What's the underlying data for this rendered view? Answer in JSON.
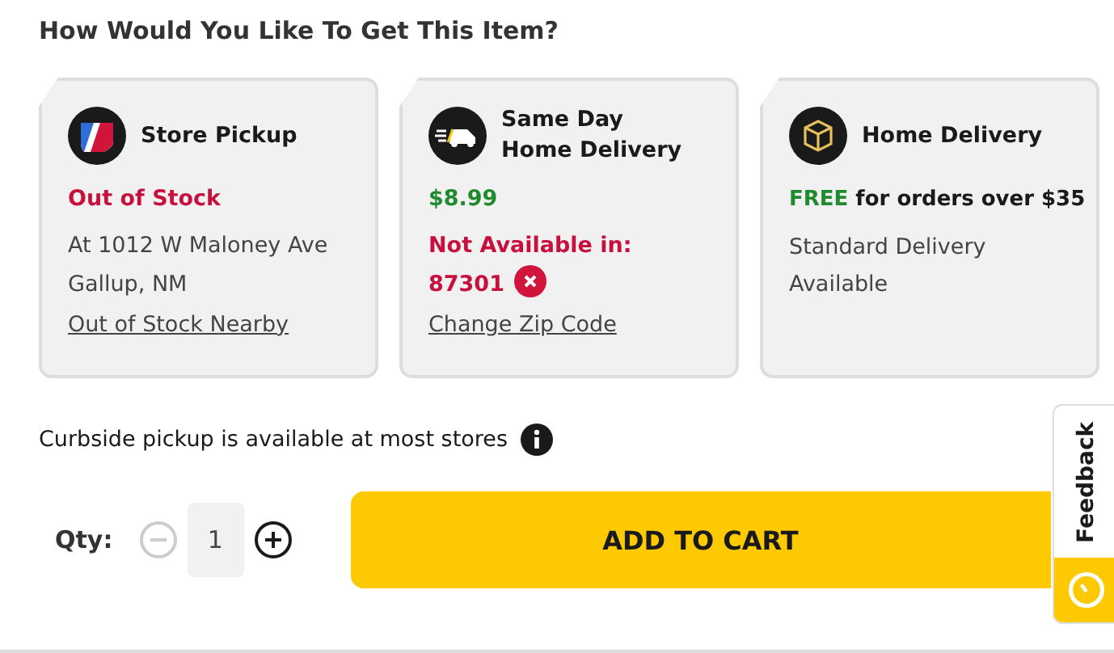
{
  "heading": "How Would You Like To Get This Item?",
  "options": [
    {
      "kind": "store",
      "title": "Store Pickup",
      "lines": [
        {
          "text": "Out of Stock",
          "kind": "alert"
        },
        {
          "text": "At 1012 W Maloney Ave\nGallup, NM",
          "kind": "plain"
        }
      ],
      "link": "Out of Stock Nearby"
    },
    {
      "kind": "sameday",
      "title": "Same Day\nHome Delivery",
      "lines": [
        {
          "text": "$8.99",
          "kind": "good"
        },
        {
          "text": "Not Available in:",
          "kind": "alert"
        },
        {
          "text": "87301",
          "kind": "alert",
          "clear": true
        }
      ],
      "link": "Change Zip Code"
    },
    {
      "kind": "home",
      "title": "Home Delivery",
      "lines": [
        {
          "text": "**FREE** for orders over $35",
          "kind": "offer"
        },
        {
          "text": "Standard Delivery\nAvailable",
          "kind": "plain"
        }
      ]
    }
  ],
  "note": "Curbside pickup is available at most stores",
  "quantity": {
    "label": "Qty:",
    "value": "1",
    "minus_disabled": true
  },
  "add_button": "ADD TO CART",
  "feedback": "Feedback"
}
